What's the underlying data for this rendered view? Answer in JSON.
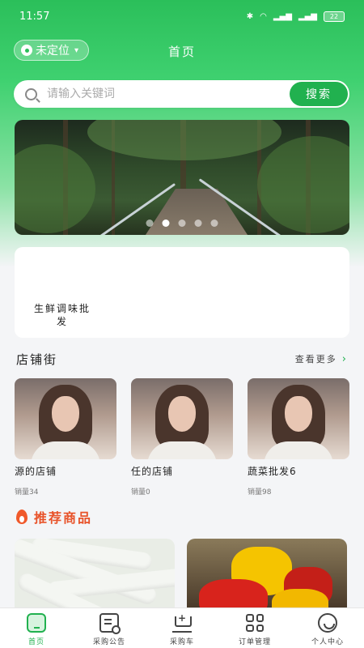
{
  "status": {
    "time": "11:57",
    "battery": "22"
  },
  "header": {
    "location_label": "未定位",
    "title": "首页"
  },
  "search": {
    "placeholder": "请输入关键词",
    "button_label": "搜索"
  },
  "banner": {
    "dot_count": 5,
    "active_dot": 1
  },
  "categories": [
    {
      "label": "生鲜调味批发"
    }
  ],
  "shops_section": {
    "title": "店铺街",
    "more_label": "查看更多"
  },
  "shops": [
    {
      "name": "源的店铺",
      "sales": "销量34"
    },
    {
      "name": "任的店铺",
      "sales": "销量0"
    },
    {
      "name": "蔬菜批发6",
      "sales": "销量98"
    }
  ],
  "recommend": {
    "title": "推荐商品"
  },
  "tabs": [
    {
      "label": "首页",
      "icon": "home-icon",
      "active": true
    },
    {
      "label": "采购公告",
      "icon": "notice-icon",
      "active": false
    },
    {
      "label": "采购车",
      "icon": "cart-icon",
      "active": false
    },
    {
      "label": "订单管理",
      "icon": "grid-icon",
      "active": false
    },
    {
      "label": "个人中心",
      "icon": "user-icon",
      "active": false
    }
  ],
  "colors": {
    "brand": "#21b14f",
    "recommend_title": "#e8532a"
  }
}
